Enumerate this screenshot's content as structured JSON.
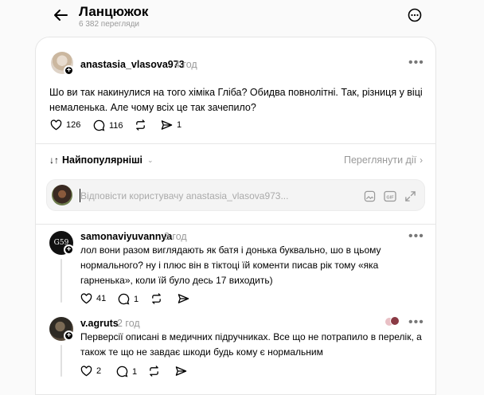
{
  "header": {
    "title": "Ланцюжок",
    "views": "6 382 перегляди",
    "back_icon": "arrow-left-icon",
    "more_icon": "more-circle-icon"
  },
  "main_post": {
    "username": "anastasia_vlasova973",
    "time": "4 год",
    "text_line1": "Шо ви так накинулися на того хіміка Гліба? Обидва повнолітні. Так, різниця у віці",
    "text_line2": "немаленька. Але чому всіх це так зачепило?",
    "likes": "126",
    "comments": "116",
    "shares": "1"
  },
  "sort": {
    "label": "Найпопулярніші",
    "view_activity": "Переглянути дії"
  },
  "reply": {
    "placeholder": "Відповісти користувачу anastasia_vlasova973..."
  },
  "comments": [
    {
      "username": "samonaviyuvannya",
      "time": "3 год",
      "avatar_text": "G59",
      "line1": "лол вони разом виглядають як батя і донька буквально, шо в цьому",
      "line2": "нормального? ну і плюс він в тіктоці їй коменти писав рік тому «яка",
      "line3": "гарненька», коли їй було десь 17 виходить)",
      "likes": "41",
      "comments": "1"
    },
    {
      "username": "v.agruts",
      "time": "2 год",
      "line1": "Перверсії описані в медичних підручниках. Все що не потрапило в перелік, а",
      "line2": "також те що не завдає шкоди будь кому є нормальним",
      "likes": "2",
      "comments": "1"
    }
  ],
  "colors": {
    "background": "#fafafa",
    "card": "#ffffff",
    "muted": "#999999",
    "border": "#e6e6e6"
  }
}
